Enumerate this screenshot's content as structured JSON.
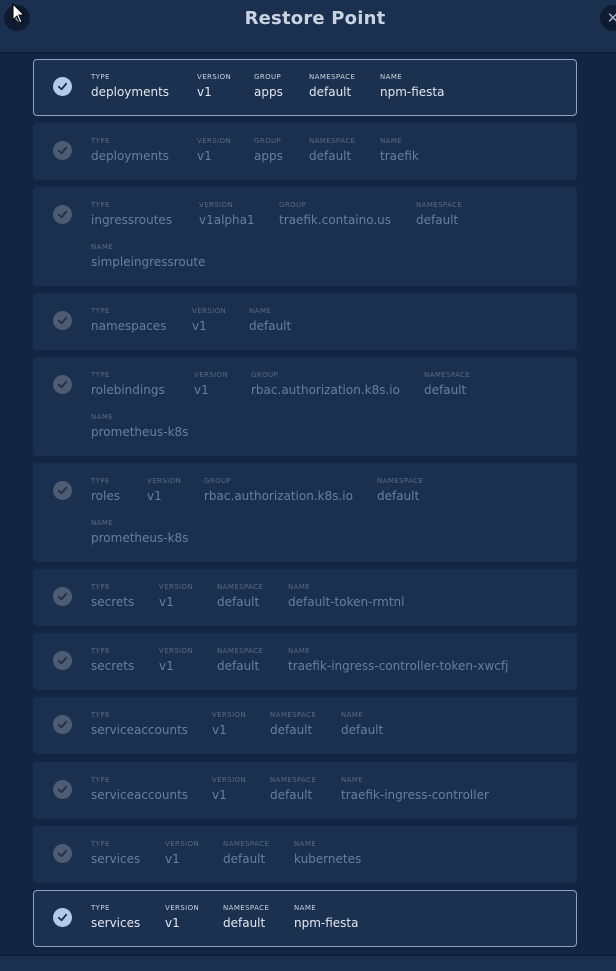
{
  "header": {
    "title": "Restore Point",
    "back_icon": "‹",
    "close_icon": "✕"
  },
  "labels": {
    "type": "TYPE",
    "version": "VERSION",
    "group": "GROUP",
    "namespace": "NAMESPACE",
    "name": "NAME"
  },
  "items": [
    {
      "type": "deployments",
      "version": "v1",
      "group": "apps",
      "namespace": "default",
      "name": "npm-fiesta",
      "selected": true
    },
    {
      "type": "deployments",
      "version": "v1",
      "group": "apps",
      "namespace": "default",
      "name": "traefik",
      "selected": false
    },
    {
      "type": "ingressroutes",
      "version": "v1alpha1",
      "group": "traefik.containo.us",
      "namespace": "default",
      "name": "simpleingressroute",
      "selected": false
    },
    {
      "type": "namespaces",
      "version": "v1",
      "name": "default",
      "selected": false
    },
    {
      "type": "rolebindings",
      "version": "v1",
      "group": "rbac.authorization.k8s.io",
      "namespace": "default",
      "name": "prometheus-k8s",
      "selected": false
    },
    {
      "type": "roles",
      "version": "v1",
      "group": "rbac.authorization.k8s.io",
      "namespace": "default",
      "name": "prometheus-k8s",
      "selected": false
    },
    {
      "type": "secrets",
      "version": "v1",
      "namespace": "default",
      "name": "default-token-rmtnl",
      "selected": false
    },
    {
      "type": "secrets",
      "version": "v1",
      "namespace": "default",
      "name": "traefik-ingress-controller-token-xwcfj",
      "selected": false
    },
    {
      "type": "serviceaccounts",
      "version": "v1",
      "namespace": "default",
      "name": "default",
      "selected": false
    },
    {
      "type": "serviceaccounts",
      "version": "v1",
      "namespace": "default",
      "name": "traefik-ingress-controller",
      "selected": false
    },
    {
      "type": "services",
      "version": "v1",
      "namespace": "default",
      "name": "kubernetes",
      "selected": false
    },
    {
      "type": "services",
      "version": "v1",
      "namespace": "default",
      "name": "npm-fiesta",
      "selected": true
    }
  ]
}
